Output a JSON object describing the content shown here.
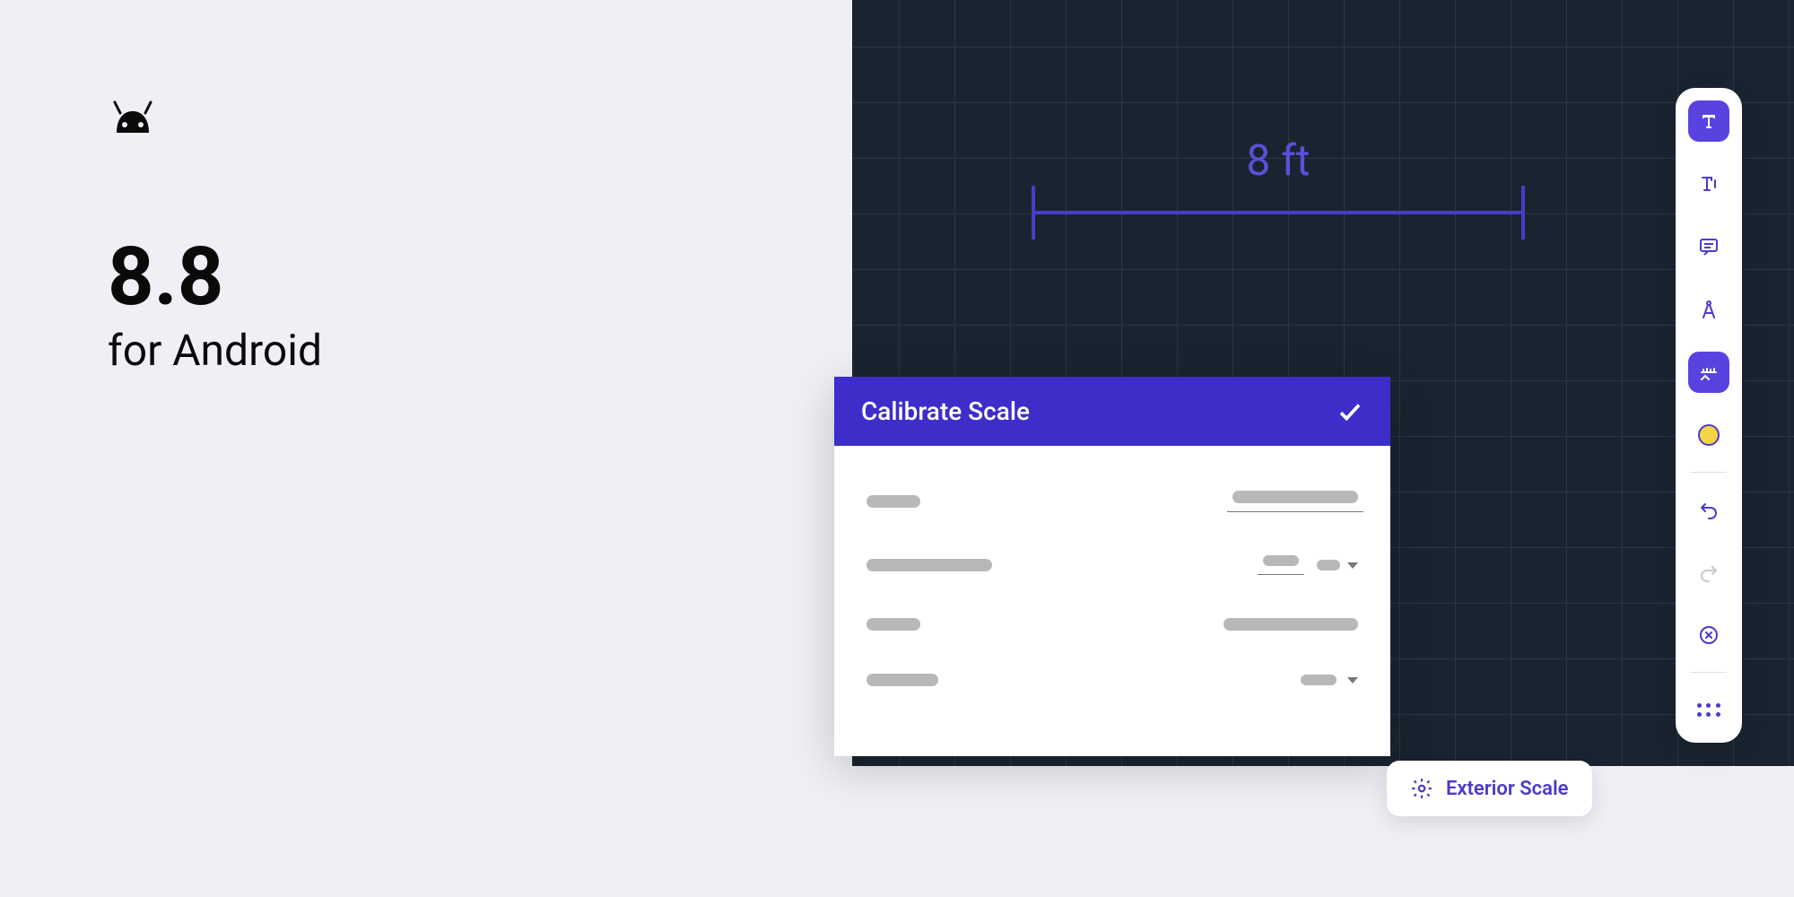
{
  "left": {
    "version": "8.8",
    "subtitle": "for Android"
  },
  "measurement": {
    "label": "8 ft"
  },
  "calibrate": {
    "title": "Calibrate Scale"
  },
  "scale_chip": {
    "label": "Exterior Scale"
  },
  "toolbar": {
    "items": [
      {
        "name": "text-tool",
        "active": true
      },
      {
        "name": "text-cursor-tool"
      },
      {
        "name": "comment-tool"
      },
      {
        "name": "compass-tool"
      },
      {
        "name": "measure-tool",
        "active": true
      },
      {
        "name": "color-picker"
      },
      {
        "name": "undo-tool"
      },
      {
        "name": "redo-tool",
        "disabled": true
      },
      {
        "name": "close-tool"
      },
      {
        "name": "drag-handle"
      }
    ],
    "color": "#f5d547"
  }
}
